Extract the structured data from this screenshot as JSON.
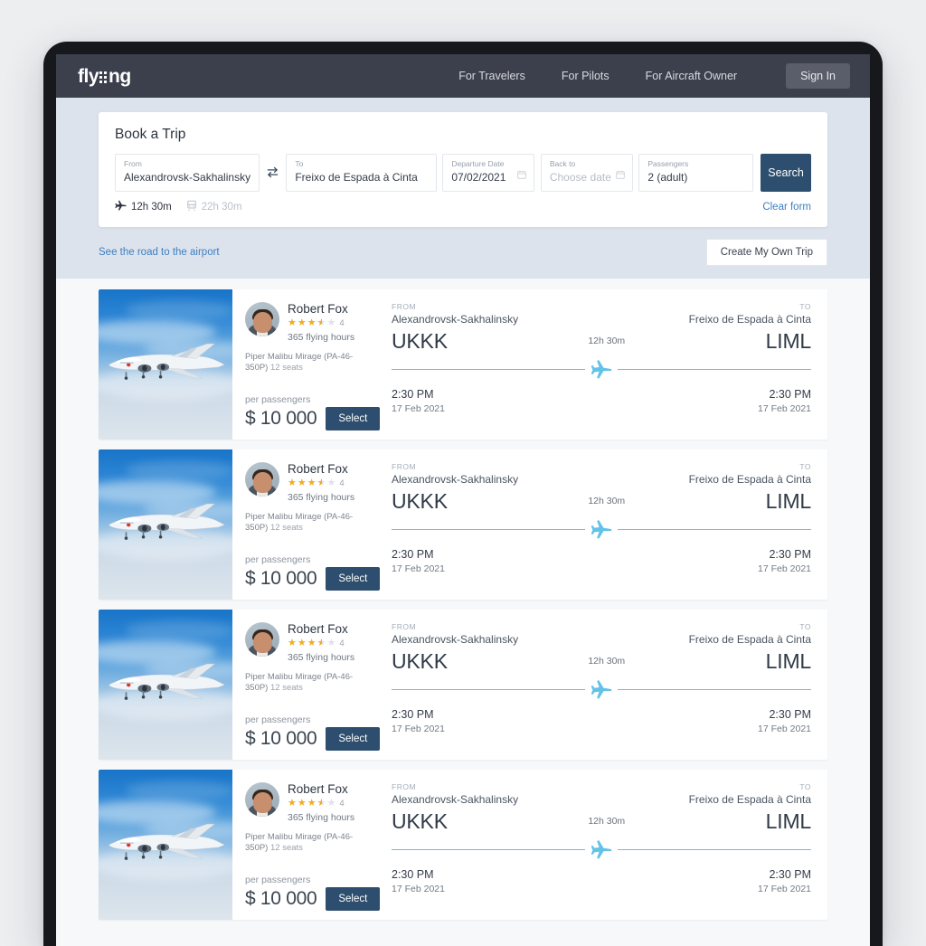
{
  "brand": {
    "logo_text_start": "fly",
    "logo_text_end": "ng",
    "logo_dots_icon": "dot-matrix-i"
  },
  "nav": {
    "links": [
      {
        "label": "For Travelers"
      },
      {
        "label": "For Pilots"
      },
      {
        "label": "For Aircraft Owner"
      }
    ],
    "signin_label": "Sign In"
  },
  "search": {
    "title": "Book a Trip",
    "from": {
      "label": "From",
      "value": "Alexandrovsk-Sakhalinsky"
    },
    "to": {
      "label": "To",
      "value": "Freixo de Espada à Cinta"
    },
    "departure": {
      "label": "Departure Date",
      "value": "07/02/2021"
    },
    "back": {
      "label": "Back to",
      "placeholder": "Choose date",
      "value": ""
    },
    "passengers": {
      "label": "Passengers",
      "value": "2 (adult)"
    },
    "search_label": "Search",
    "clear_label": "Clear form",
    "swap_icon": "swap-arrows-icon",
    "calendar_icon": "calendar-icon",
    "modes": [
      {
        "icon": "airplane-icon",
        "label": "12h 30m",
        "active": true
      },
      {
        "icon": "train-icon",
        "label": "22h 30m",
        "active": false
      }
    ]
  },
  "band_footer": {
    "road_link": "See the road to the airport",
    "own_trip_label": "Create My Own Trip"
  },
  "results": [
    {
      "photo_icon": "airplane-photo",
      "pilot": {
        "name": "Robert Fox",
        "rating_full": 3,
        "rating_half": true,
        "rating_empty": 1,
        "rating_count": "4",
        "hours": "365 flying hours",
        "aircraft": "Piper Malibu Mirage (PA-46-350P)",
        "seats": "12 seats",
        "avatar_icon": "pilot-avatar"
      },
      "price": {
        "caption": "per passengers",
        "amount": "$ 10 000",
        "select_label": "Select"
      },
      "route": {
        "from_caption": "FROM",
        "from_city": "Alexandrovsk-Sakhalinsky",
        "from_code": "UKKK",
        "to_caption": "TO",
        "to_city": "Freixo de Espada à Cinta",
        "to_code": "LIML",
        "duration": "12h 30m",
        "depart_time": "2:30 PM",
        "depart_date": "17 Feb 2021",
        "arrive_time": "2:30 PM",
        "arrive_date": "17 Feb 2021",
        "plane_icon": "airplane-icon"
      }
    },
    {
      "photo_icon": "airplane-photo",
      "pilot": {
        "name": "Robert Fox",
        "rating_full": 3,
        "rating_half": true,
        "rating_empty": 1,
        "rating_count": "4",
        "hours": "365 flying hours",
        "aircraft": "Piper Malibu Mirage (PA-46-350P)",
        "seats": "12 seats",
        "avatar_icon": "pilot-avatar"
      },
      "price": {
        "caption": "per passengers",
        "amount": "$ 10 000",
        "select_label": "Select"
      },
      "route": {
        "from_caption": "FROM",
        "from_city": "Alexandrovsk-Sakhalinsky",
        "from_code": "UKKK",
        "to_caption": "TO",
        "to_city": "Freixo de Espada à Cinta",
        "to_code": "LIML",
        "duration": "12h 30m",
        "depart_time": "2:30 PM",
        "depart_date": "17 Feb 2021",
        "arrive_time": "2:30 PM",
        "arrive_date": "17 Feb 2021",
        "plane_icon": "airplane-icon"
      }
    },
    {
      "photo_icon": "airplane-photo",
      "pilot": {
        "name": "Robert Fox",
        "rating_full": 3,
        "rating_half": true,
        "rating_empty": 1,
        "rating_count": "4",
        "hours": "365 flying hours",
        "aircraft": "Piper Malibu Mirage (PA-46-350P)",
        "seats": "12 seats",
        "avatar_icon": "pilot-avatar"
      },
      "price": {
        "caption": "per passengers",
        "amount": "$ 10 000",
        "select_label": "Select"
      },
      "route": {
        "from_caption": "FROM",
        "from_city": "Alexandrovsk-Sakhalinsky",
        "from_code": "UKKK",
        "to_caption": "TO",
        "to_city": "Freixo de Espada à Cinta",
        "to_code": "LIML",
        "duration": "12h 30m",
        "depart_time": "2:30 PM",
        "depart_date": "17 Feb 2021",
        "arrive_time": "2:30 PM",
        "arrive_date": "17 Feb 2021",
        "plane_icon": "airplane-icon"
      }
    },
    {
      "photo_icon": "airplane-photo",
      "pilot": {
        "name": "Robert Fox",
        "rating_full": 3,
        "rating_half": true,
        "rating_empty": 1,
        "rating_count": "4",
        "hours": "365 flying hours",
        "aircraft": "Piper Malibu Mirage (PA-46-350P)",
        "seats": "12 seats",
        "avatar_icon": "pilot-avatar"
      },
      "price": {
        "caption": "per passengers",
        "amount": "$ 10 000",
        "select_label": "Select"
      },
      "route": {
        "from_caption": "FROM",
        "from_city": "Alexandrovsk-Sakhalinsky",
        "from_code": "UKKK",
        "to_caption": "TO",
        "to_city": "Freixo de Espada à Cinta",
        "to_code": "LIML",
        "duration": "12h 30m",
        "depart_time": "2:30 PM",
        "depart_date": "17 Feb 2021",
        "arrive_time": "2:30 PM",
        "arrive_date": "17 Feb 2021",
        "plane_icon": "airplane-icon"
      }
    }
  ],
  "colors": {
    "navbar": "#3c404d",
    "band": "#dde3ec",
    "accent_blue": "#62c2e8",
    "button_navy": "#2d4e6e",
    "link_blue": "#3d7fc1",
    "star_gold": "#f0ad1e"
  }
}
